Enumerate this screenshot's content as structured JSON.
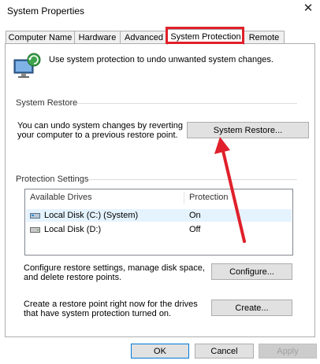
{
  "window": {
    "title": "System Properties"
  },
  "tabs": [
    {
      "label": "Computer Name"
    },
    {
      "label": "Hardware"
    },
    {
      "label": "Advanced"
    },
    {
      "label": "System Protection",
      "selected": true
    },
    {
      "label": "Remote"
    }
  ],
  "intro": {
    "text": "Use system protection to undo unwanted system changes."
  },
  "restore": {
    "group_label": "System Restore",
    "description": "You can undo system changes by reverting your computer to a previous restore point.",
    "button_label": "System Restore..."
  },
  "protection": {
    "group_label": "Protection Settings",
    "columns": [
      "Available Drives",
      "Protection"
    ],
    "drives": [
      {
        "name": "Local Disk (C:) (System)",
        "protection": "On",
        "selected": true,
        "icon": "system-drive-icon"
      },
      {
        "name": "Local Disk (D:)",
        "protection": "Off",
        "selected": false,
        "icon": "drive-icon"
      }
    ],
    "configure_text": "Configure restore settings, manage disk space, and delete restore points.",
    "configure_label": "Configure...",
    "create_text": "Create a restore point right now for the drives that have system protection turned on.",
    "create_label": "Create..."
  },
  "footer": {
    "ok_label": "OK",
    "cancel_label": "Cancel",
    "apply_label": "Apply"
  },
  "annotation": {
    "highlight_color": "#e0202a",
    "arrow_color": "#e0202a"
  }
}
